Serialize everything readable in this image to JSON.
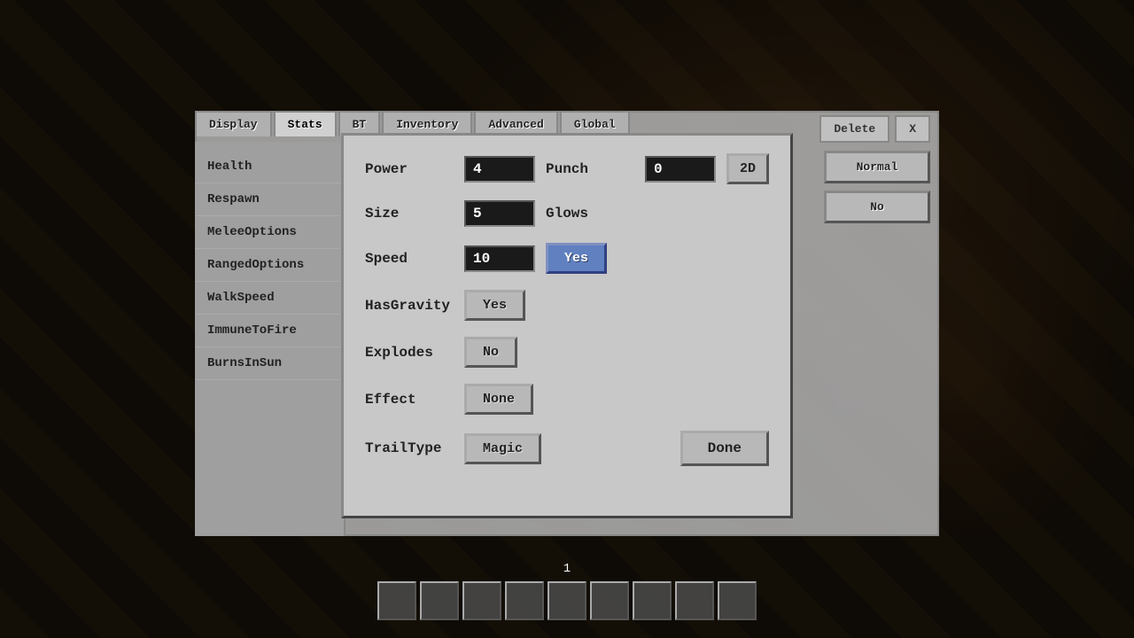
{
  "background": {
    "color": "#1a1a1a"
  },
  "tabs": {
    "items": [
      {
        "label": "Display",
        "active": false
      },
      {
        "label": "Stats",
        "active": true
      },
      {
        "label": "BT",
        "active": false
      },
      {
        "label": "Inventory",
        "active": false
      },
      {
        "label": "Advanced",
        "active": false
      },
      {
        "label": "Global",
        "active": false
      }
    ]
  },
  "header_buttons": {
    "delete_label": "Delete",
    "close_label": "X"
  },
  "sidebar": {
    "items": [
      {
        "label": "Health"
      },
      {
        "label": "Respawn"
      },
      {
        "label": "MeleeOptions"
      },
      {
        "label": "RangedOptions"
      },
      {
        "label": "WalkSpeed"
      },
      {
        "label": "ImmuneToFire"
      },
      {
        "label": "BurnsInSun"
      }
    ]
  },
  "right_panel": {
    "buttons": [
      {
        "label": "Normal"
      },
      {
        "label": "No"
      }
    ]
  },
  "dialog": {
    "fields": {
      "power": {
        "label": "Power",
        "value": "4"
      },
      "punch": {
        "label": "Punch",
        "value": "0",
        "button_2d": "2D"
      },
      "size": {
        "label": "Size",
        "value": "5"
      },
      "glows": {
        "label": "Glows",
        "button_label": "Yes",
        "active": true
      },
      "speed": {
        "label": "Speed",
        "value": "10",
        "button_label": "Yes",
        "active": true
      },
      "has_gravity": {
        "label": "HasGravity",
        "button_label": "Yes",
        "active": false
      },
      "explodes": {
        "label": "Explodes",
        "button_label": "No",
        "active": false
      },
      "effect": {
        "label": "Effect",
        "button_label": "None",
        "active": false
      },
      "trail_type": {
        "label": "TrailType",
        "button_label": "Magic",
        "active": false
      }
    },
    "done_button": "Done"
  },
  "hotbar": {
    "counter": "1",
    "slots": 9
  }
}
